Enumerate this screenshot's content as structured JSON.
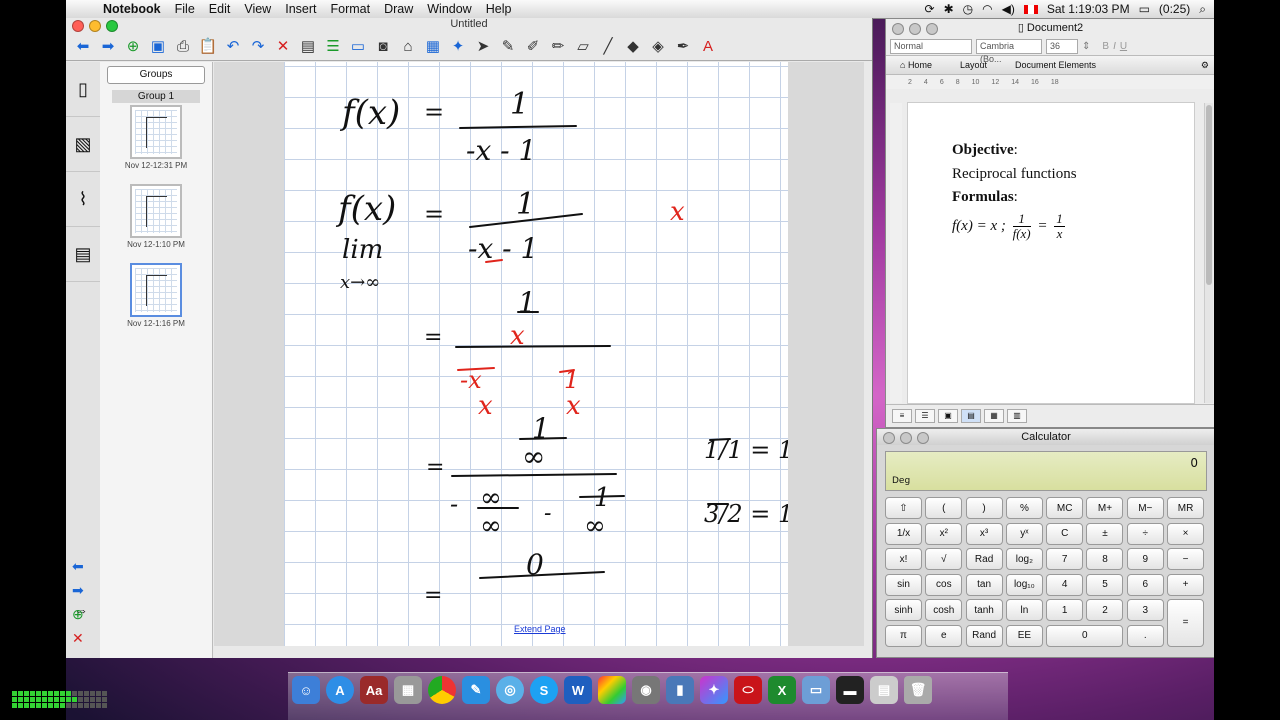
{
  "menubar": {
    "app": "Notebook",
    "items": [
      "File",
      "Edit",
      "View",
      "Insert",
      "Format",
      "Draw",
      "Window",
      "Help"
    ],
    "clock": "Sat 1:19:03 PM",
    "battery": "(0:25)"
  },
  "notebook": {
    "title": "Untitled",
    "groups_button": "Groups",
    "group_label": "Group 1",
    "pages": [
      {
        "caption": "Nov 12-12:31 PM"
      },
      {
        "caption": "Nov 12-1:10 PM"
      },
      {
        "caption": "Nov 12-1:16 PM"
      }
    ],
    "extend_page": "Extend Page",
    "ink": {
      "f": "f(x)",
      "eq": "=",
      "one": "1",
      "den1": "-x - 1",
      "den2": "-x - 1",
      "x1": "x",
      "lim": "lim",
      "limsub": "x→∞",
      "x": "x",
      "mx": "-x",
      "minus": "-",
      "inf": "∞",
      "zero": "0",
      "r1": "1/1 = 1",
      "r2": "3/2 = 1"
    }
  },
  "word": {
    "title": "Document2",
    "style": "Normal",
    "font": "Cambria (Bo...",
    "size": "36",
    "tabs": [
      "Home",
      "Layout",
      "Document Elements"
    ],
    "ruler": [
      "2",
      "4",
      "6",
      "8",
      "10",
      "12",
      "14",
      "16",
      "18"
    ],
    "objective_label": "Objective",
    "objective_colon": ":",
    "objective_text": "Reciprocal functions",
    "formulas_label": "Formulas",
    "formulas_colon": ":",
    "formula_left": "f(x) = x ;",
    "frac1_num": "1",
    "frac1_den": "f(x)",
    "formula_eq": "=",
    "frac2_num": "1",
    "frac2_den": "x"
  },
  "calculator": {
    "title": "Calculator",
    "display": "0",
    "mode": "Deg",
    "keys": [
      "⇧",
      "(",
      ")",
      "%",
      "MC",
      "M+",
      "M−",
      "MR",
      "1/x",
      "x²",
      "x³",
      "yˣ",
      "C",
      "±",
      "÷",
      "×",
      "x!",
      "√",
      "Rad",
      "log₂",
      "7",
      "8",
      "9",
      "−",
      "sin",
      "cos",
      "tan",
      "log₁₀",
      "4",
      "5",
      "6",
      "+",
      "sinh",
      "cosh",
      "tanh",
      "ln",
      "1",
      "2",
      "3",
      "=",
      "π",
      "e",
      "Rand",
      "EE",
      "0",
      "."
    ]
  },
  "colors": {
    "ink_black": "#111111",
    "ink_red": "#e0241b",
    "grid": "#c5d2e6",
    "lcd": "#e1e7b6"
  },
  "dock_icons": [
    "finder-icon",
    "app-store-icon",
    "dictionary-icon",
    "calculator-icon",
    "chrome-icon",
    "notes-icon",
    "quicktime-icon",
    "skype-icon",
    "word-icon",
    "color-picker-icon",
    "screenshot-icon",
    "file-icon",
    "grapher-icon",
    "pdf-icon",
    "excel-icon",
    "folder-icon",
    "terminal-icon",
    "finder-window-icon",
    "trash-icon"
  ]
}
